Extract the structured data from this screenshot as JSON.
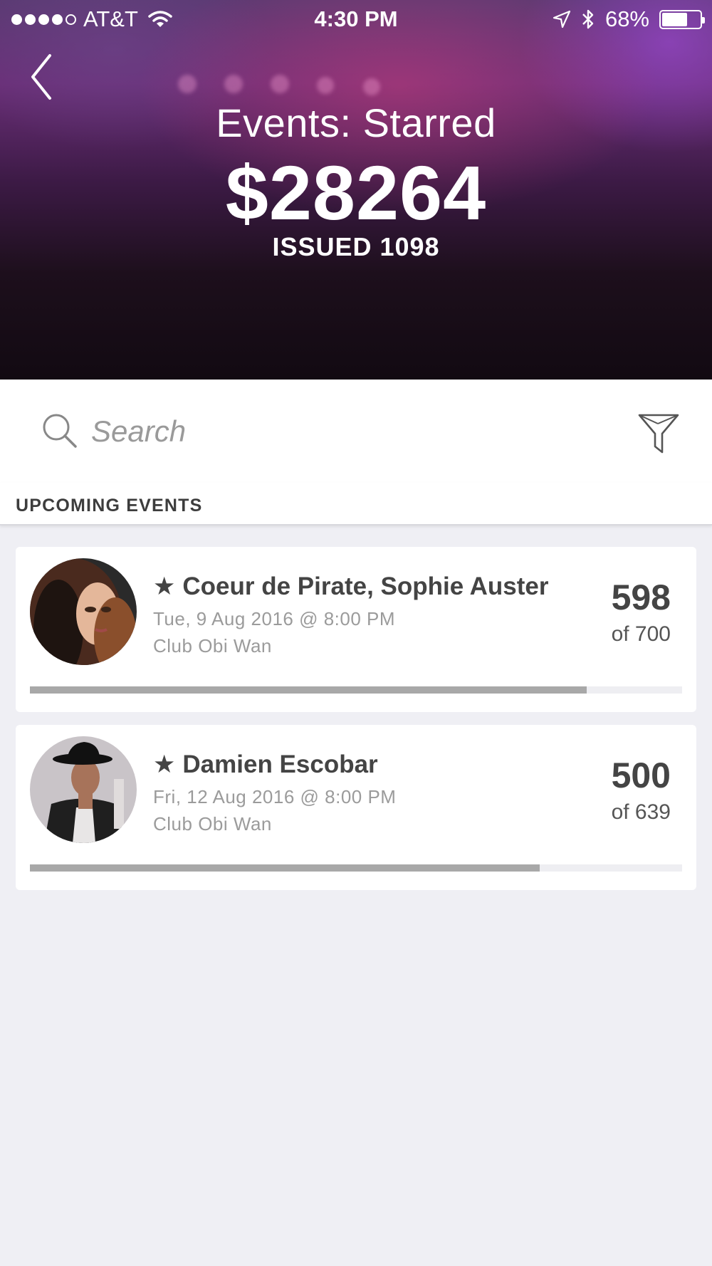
{
  "status_bar": {
    "carrier": "AT&T",
    "time": "4:30 PM",
    "battery": "68%",
    "battery_level": 0.68
  },
  "header": {
    "title": "Events: Starred",
    "amount": "$28264",
    "issued": "ISSUED 1098"
  },
  "search": {
    "placeholder": "Search"
  },
  "section": {
    "title": "UPCOMING EVENTS"
  },
  "events": [
    {
      "starred": "★",
      "title": "Coeur de Pirate, Sophie Auster",
      "date": "Tue, 9 Aug 2016 @ 8:00 PM",
      "venue": "Club Obi Wan",
      "sold": "598",
      "capacity": "of 700",
      "progress": 0.854
    },
    {
      "starred": "★",
      "title": "Damien Escobar",
      "date": "Fri, 12 Aug 2016 @ 8:00 PM",
      "venue": "Club Obi Wan",
      "sold": "500",
      "capacity": "of 639",
      "progress": 0.782
    }
  ],
  "colors": {
    "background": "#efeff4",
    "progress_fill": "#a8a8a8",
    "progress_track": "#eeeef2",
    "text_dark": "#444444",
    "text_muted": "#9b9b9b"
  }
}
